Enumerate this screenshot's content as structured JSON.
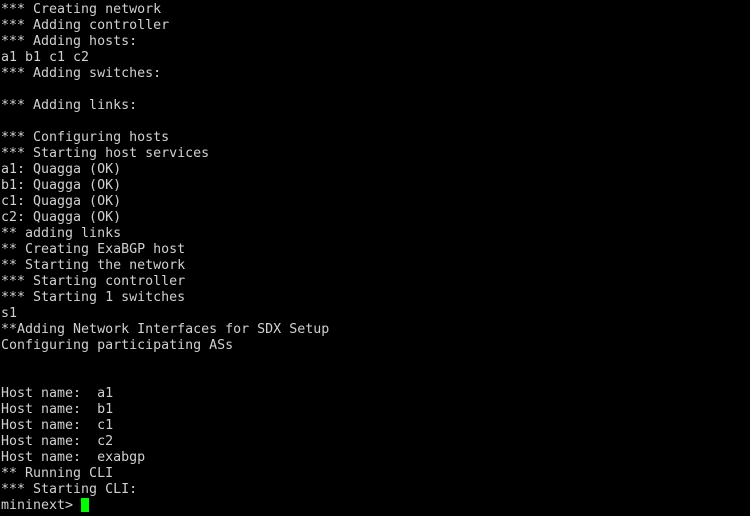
{
  "terminal": {
    "background_color": "#000000",
    "text_color": "#d0d0d0",
    "cursor_color": "#00ff00",
    "lines": [
      "*** Creating network",
      "*** Adding controller",
      "*** Adding hosts:",
      "a1 b1 c1 c2",
      "*** Adding switches:",
      "",
      "*** Adding links:",
      "",
      "*** Configuring hosts",
      "*** Starting host services",
      "a1: Quagga (OK)",
      "b1: Quagga (OK)",
      "c1: Quagga (OK)",
      "c2: Quagga (OK)",
      "** adding links",
      "** Creating ExaBGP host",
      "** Starting the network",
      "*** Starting controller",
      "*** Starting 1 switches",
      "s1",
      "**Adding Network Interfaces for SDX Setup",
      "Configuring participating ASs",
      "",
      "",
      "Host name:  a1",
      "Host name:  b1",
      "Host name:  c1",
      "Host name:  c2",
      "Host name:  exabgp",
      "** Running CLI",
      "*** Starting CLI:"
    ],
    "prompt": "mininext> ",
    "cursor": "block-cursor"
  }
}
